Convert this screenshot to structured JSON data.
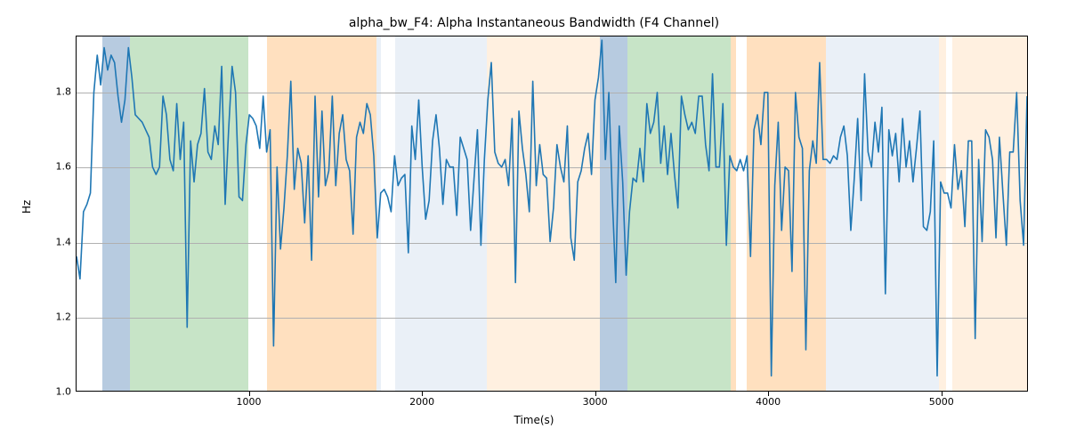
{
  "chart_data": {
    "type": "line",
    "title": "alpha_bw_F4: Alpha Instantaneous Bandwidth (F4 Channel)",
    "xlabel": "Time(s)",
    "ylabel": "Hz",
    "xlim": [
      0,
      5500
    ],
    "ylim": [
      1.0,
      1.95
    ],
    "xticks": [
      1000,
      2000,
      3000,
      4000,
      5000
    ],
    "yticks": [
      1.0,
      1.2,
      1.4,
      1.6,
      1.8
    ],
    "bands": [
      {
        "x0": 150,
        "x1": 310,
        "color": "#b7cbe0"
      },
      {
        "x0": 310,
        "x1": 990,
        "color": "#c7e4c7"
      },
      {
        "x0": 1100,
        "x1": 1730,
        "color": "#ffe0bf"
      },
      {
        "x0": 1730,
        "x1": 1760,
        "color": "#eaf0f7"
      },
      {
        "x0": 1840,
        "x1": 2370,
        "color": "#eaf0f7"
      },
      {
        "x0": 2370,
        "x1": 3020,
        "color": "#fff0e0"
      },
      {
        "x0": 3020,
        "x1": 3180,
        "color": "#b7cbe0"
      },
      {
        "x0": 3180,
        "x1": 3780,
        "color": "#c7e4c7"
      },
      {
        "x0": 3780,
        "x1": 3810,
        "color": "#ffe0bf"
      },
      {
        "x0": 3870,
        "x1": 4330,
        "color": "#ffe0bf"
      },
      {
        "x0": 4330,
        "x1": 4980,
        "color": "#eaf0f7"
      },
      {
        "x0": 4980,
        "x1": 5020,
        "color": "#fff0e0"
      },
      {
        "x0": 5060,
        "x1": 5500,
        "color": "#fff0e0"
      }
    ],
    "x": [
      0,
      20,
      40,
      60,
      80,
      100,
      120,
      140,
      160,
      180,
      200,
      220,
      240,
      260,
      280,
      300,
      320,
      340,
      360,
      380,
      400,
      420,
      440,
      460,
      480,
      500,
      520,
      540,
      560,
      580,
      600,
      620,
      640,
      660,
      680,
      700,
      720,
      740,
      760,
      780,
      800,
      820,
      840,
      860,
      880,
      900,
      920,
      940,
      960,
      980,
      1000,
      1020,
      1040,
      1060,
      1080,
      1100,
      1120,
      1140,
      1160,
      1180,
      1200,
      1220,
      1240,
      1260,
      1280,
      1300,
      1320,
      1340,
      1360,
      1380,
      1400,
      1420,
      1440,
      1460,
      1480,
      1500,
      1520,
      1540,
      1560,
      1580,
      1600,
      1620,
      1640,
      1660,
      1680,
      1700,
      1720,
      1740,
      1760,
      1780,
      1800,
      1820,
      1840,
      1860,
      1880,
      1900,
      1920,
      1940,
      1960,
      1980,
      2000,
      2020,
      2040,
      2060,
      2080,
      2100,
      2120,
      2140,
      2160,
      2180,
      2200,
      2220,
      2240,
      2260,
      2280,
      2300,
      2320,
      2340,
      2360,
      2380,
      2400,
      2420,
      2440,
      2460,
      2480,
      2500,
      2520,
      2540,
      2560,
      2580,
      2600,
      2620,
      2640,
      2660,
      2680,
      2700,
      2720,
      2740,
      2760,
      2780,
      2800,
      2820,
      2840,
      2860,
      2880,
      2900,
      2920,
      2940,
      2960,
      2980,
      3000,
      3020,
      3040,
      3060,
      3080,
      3100,
      3120,
      3140,
      3160,
      3180,
      3200,
      3220,
      3240,
      3260,
      3280,
      3300,
      3320,
      3340,
      3360,
      3380,
      3400,
      3420,
      3440,
      3460,
      3480,
      3500,
      3520,
      3540,
      3560,
      3580,
      3600,
      3620,
      3640,
      3660,
      3680,
      3700,
      3720,
      3740,
      3760,
      3780,
      3800,
      3820,
      3840,
      3860,
      3880,
      3900,
      3920,
      3940,
      3960,
      3980,
      4000,
      4020,
      4040,
      4060,
      4080,
      4100,
      4120,
      4140,
      4160,
      4180,
      4200,
      4220,
      4240,
      4260,
      4280,
      4300,
      4320,
      4340,
      4360,
      4380,
      4400,
      4420,
      4440,
      4460,
      4480,
      4500,
      4520,
      4540,
      4560,
      4580,
      4600,
      4620,
      4640,
      4660,
      4680,
      4700,
      4720,
      4740,
      4760,
      4780,
      4800,
      4820,
      4840,
      4860,
      4880,
      4900,
      4920,
      4940,
      4960,
      4980,
      5000,
      5020,
      5040,
      5060,
      5080,
      5100,
      5120,
      5140,
      5160,
      5180,
      5200,
      5220,
      5240,
      5260,
      5280,
      5300,
      5320,
      5340,
      5360,
      5380,
      5400,
      5420,
      5440,
      5460,
      5480,
      5500
    ],
    "values": [
      1.36,
      1.3,
      1.48,
      1.5,
      1.53,
      1.8,
      1.9,
      1.82,
      1.92,
      1.86,
      1.9,
      1.88,
      1.79,
      1.72,
      1.78,
      1.92,
      1.84,
      1.74,
      1.73,
      1.72,
      1.7,
      1.68,
      1.6,
      1.58,
      1.6,
      1.79,
      1.74,
      1.62,
      1.59,
      1.77,
      1.62,
      1.72,
      1.17,
      1.67,
      1.56,
      1.66,
      1.69,
      1.81,
      1.64,
      1.62,
      1.71,
      1.66,
      1.87,
      1.5,
      1.7,
      1.87,
      1.8,
      1.52,
      1.51,
      1.66,
      1.74,
      1.73,
      1.71,
      1.65,
      1.79,
      1.64,
      1.7,
      1.12,
      1.6,
      1.38,
      1.49,
      1.63,
      1.83,
      1.54,
      1.65,
      1.61,
      1.45,
      1.63,
      1.35,
      1.79,
      1.52,
      1.75,
      1.55,
      1.59,
      1.79,
      1.55,
      1.69,
      1.74,
      1.62,
      1.59,
      1.42,
      1.68,
      1.72,
      1.69,
      1.77,
      1.74,
      1.63,
      1.41,
      1.53,
      1.54,
      1.52,
      1.48,
      1.63,
      1.55,
      1.57,
      1.58,
      1.37,
      1.71,
      1.62,
      1.78,
      1.6,
      1.46,
      1.51,
      1.67,
      1.74,
      1.65,
      1.5,
      1.62,
      1.6,
      1.6,
      1.47,
      1.68,
      1.65,
      1.62,
      1.43,
      1.57,
      1.7,
      1.39,
      1.62,
      1.78,
      1.88,
      1.64,
      1.61,
      1.6,
      1.62,
      1.55,
      1.73,
      1.29,
      1.75,
      1.65,
      1.58,
      1.48,
      1.83,
      1.55,
      1.66,
      1.58,
      1.57,
      1.4,
      1.49,
      1.66,
      1.6,
      1.56,
      1.71,
      1.41,
      1.35,
      1.56,
      1.59,
      1.65,
      1.69,
      1.58,
      1.78,
      1.84,
      1.94,
      1.62,
      1.8,
      1.52,
      1.29,
      1.71,
      1.56,
      1.31,
      1.48,
      1.57,
      1.56,
      1.65,
      1.56,
      1.77,
      1.69,
      1.72,
      1.8,
      1.61,
      1.71,
      1.58,
      1.69,
      1.58,
      1.49,
      1.79,
      1.74,
      1.7,
      1.72,
      1.69,
      1.79,
      1.79,
      1.66,
      1.59,
      1.85,
      1.6,
      1.6,
      1.77,
      1.39,
      1.63,
      1.6,
      1.59,
      1.62,
      1.59,
      1.63,
      1.36,
      1.7,
      1.74,
      1.66,
      1.8,
      1.8,
      1.04,
      1.55,
      1.72,
      1.43,
      1.6,
      1.59,
      1.32,
      1.8,
      1.68,
      1.65,
      1.11,
      1.59,
      1.67,
      1.61,
      1.88,
      1.62,
      1.62,
      1.61,
      1.63,
      1.62,
      1.68,
      1.71,
      1.63,
      1.43,
      1.57,
      1.73,
      1.51,
      1.85,
      1.64,
      1.6,
      1.72,
      1.64,
      1.76,
      1.26,
      1.7,
      1.63,
      1.69,
      1.56,
      1.73,
      1.6,
      1.67,
      1.56,
      1.65,
      1.75,
      1.44,
      1.43,
      1.48,
      1.67,
      1.04,
      1.56,
      1.53,
      1.53,
      1.49,
      1.66,
      1.54,
      1.59,
      1.44,
      1.67,
      1.67,
      1.14,
      1.62,
      1.4,
      1.7,
      1.68,
      1.62,
      1.41,
      1.68,
      1.53,
      1.39,
      1.64,
      1.64,
      1.8,
      1.51,
      1.39,
      1.79
    ]
  }
}
